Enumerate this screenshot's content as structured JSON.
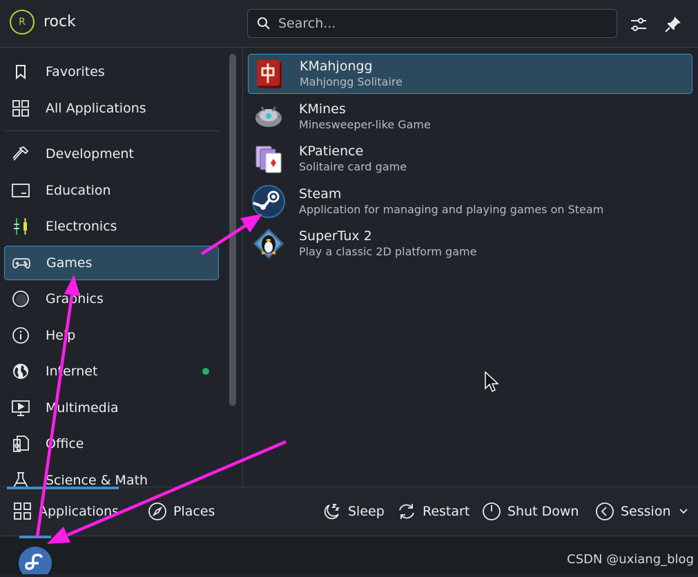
{
  "header": {
    "user_initial": "R",
    "username": "rock",
    "search_placeholder": "Search..."
  },
  "sidebar": {
    "top_items": [
      {
        "label": "Favorites",
        "icon": "bookmark-icon"
      },
      {
        "label": "All Applications",
        "icon": "grid-icon"
      }
    ],
    "categories": [
      {
        "label": "Development",
        "icon": "hammer-icon"
      },
      {
        "label": "Education",
        "icon": "screen-icon"
      },
      {
        "label": "Electronics",
        "icon": "electronics-icon"
      },
      {
        "label": "Games",
        "icon": "gamepad-icon",
        "selected": true
      },
      {
        "label": "Graphics",
        "icon": "graphics-icon"
      },
      {
        "label": "Help",
        "icon": "info-icon"
      },
      {
        "label": "Internet",
        "icon": "globe-icon",
        "has_new": true
      },
      {
        "label": "Multimedia",
        "icon": "multimedia-icon"
      },
      {
        "label": "Office",
        "icon": "office-icon"
      },
      {
        "label": "Science & Math",
        "icon": "flask-icon"
      }
    ]
  },
  "apps": [
    {
      "name": "KMahjongg",
      "desc": "Mahjongg Solitaire",
      "icon": "mahjongg-icon",
      "selected": true
    },
    {
      "name": "KMines",
      "desc": "Minesweeper-like Game",
      "icon": "mine-icon"
    },
    {
      "name": "KPatience",
      "desc": "Solitaire card game",
      "icon": "cards-icon"
    },
    {
      "name": "Steam",
      "desc": "Application for managing and playing games on Steam",
      "icon": "steam-icon"
    },
    {
      "name": "SuperTux 2",
      "desc": "Play a classic 2D platform game",
      "icon": "tux-icon"
    }
  ],
  "footer": {
    "tabs": [
      {
        "label": "Applications",
        "icon": "grid-icon",
        "active": true
      },
      {
        "label": "Places",
        "icon": "compass-icon"
      }
    ],
    "actions": [
      {
        "label": "Sleep",
        "icon": "sleep-icon"
      },
      {
        "label": "Restart",
        "icon": "restart-icon"
      },
      {
        "label": "Shut Down",
        "icon": "power-icon"
      },
      {
        "label": "Session",
        "icon": "session-icon"
      }
    ]
  },
  "panel": {
    "launcher_icon": "fedora-icon"
  },
  "watermark": "CSDN @uxiang_blog",
  "colors": {
    "accent": "#3d8fc9",
    "annotation": "#ff1ee8",
    "selection_bg": "#2c4a5e",
    "background": "#20242a"
  }
}
